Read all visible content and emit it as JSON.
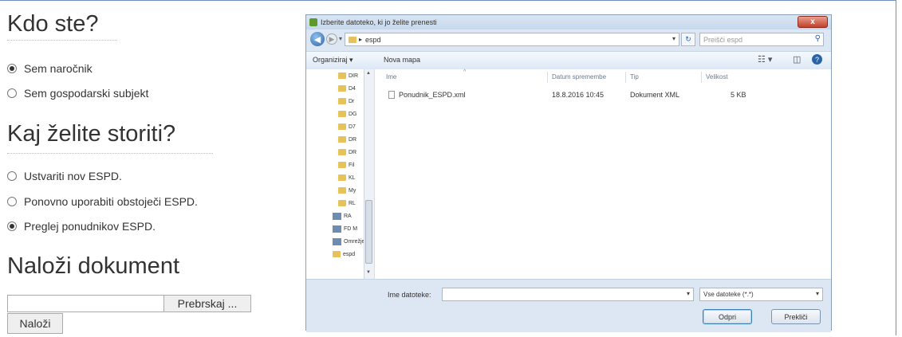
{
  "form": {
    "heading_who": "Kdo ste?",
    "role_options": [
      {
        "label": "Sem naročnik",
        "checked": true
      },
      {
        "label": "Sem gospodarski subjekt",
        "checked": false
      }
    ],
    "heading_action": "Kaj želite storiti?",
    "action_options": [
      {
        "label": "Ustvariti nov ESPD.",
        "checked": false
      },
      {
        "label": "Ponovno uporabiti obstoječi ESPD.",
        "checked": false
      },
      {
        "label": "Preglej ponudnikov ESPD.",
        "checked": true
      }
    ],
    "heading_upload": "Naloži dokument",
    "browse_label": "Prebrskaj ...",
    "upload_label": "Naloži"
  },
  "dialog": {
    "title": "Izberite datoteko, ki jo želite prenesti",
    "close_label": "x",
    "address": "espd",
    "search_placeholder": "Preišči espd",
    "organize_label": "Organiziraj ▾",
    "new_folder_label": "Nova mapa",
    "nav_items": [
      "DIR",
      "D4",
      "Dr",
      "DG",
      "D7",
      "DR",
      "DR",
      "Fil",
      "KL",
      "My",
      "RL",
      "RA",
      "FD M",
      "Omrežje",
      "espd"
    ],
    "columns": [
      "Ime",
      "Datum spremembe",
      "Tip",
      "Velikost"
    ],
    "files": [
      {
        "name": "Ponudnik_ESPD.xml",
        "date": "18.8.2016 10:45",
        "type": "Dokument XML",
        "size": "5 KB"
      }
    ],
    "filename_label": "Ime datoteke:",
    "filter_value": "Vse datoteke (*.*)",
    "open_label": "Odpri",
    "cancel_label": "Prekliči"
  }
}
